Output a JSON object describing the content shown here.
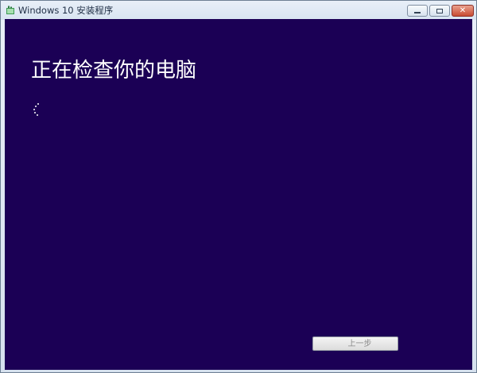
{
  "window": {
    "title": "Windows 10 安装程序",
    "icon": "setup-app-icon",
    "controls": [
      "minimize-icon",
      "maximize-icon",
      "close-icon"
    ]
  },
  "main": {
    "heading": "正在检查你的电脑",
    "progress_indicator": "loading-spinner-icon",
    "background_color": "#1B0055",
    "text_color": "#FFFFFF"
  },
  "footer": {
    "back_label": "上一步"
  }
}
